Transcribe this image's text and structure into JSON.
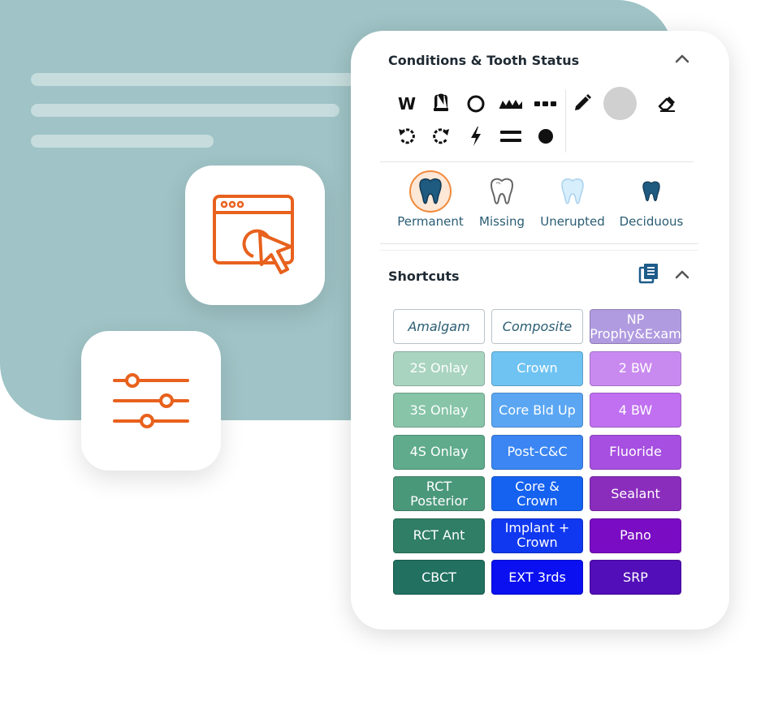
{
  "conditions": {
    "title": "Conditions & Tooth Status",
    "tools": [
      {
        "name": "wear-tool",
        "text": "W"
      },
      {
        "name": "crown-tool",
        "icon": "crown-icon"
      },
      {
        "name": "circle-tool",
        "icon": "circle-outline-icon"
      },
      {
        "name": "zigzag-tool",
        "icon": "zigzag-icon"
      },
      {
        "name": "dots-tool",
        "icon": "dots-icon"
      },
      {
        "name": "rotate-left-tool",
        "icon": "rotate-left-icon"
      },
      {
        "name": "rotate-right-tool",
        "icon": "rotate-right-icon"
      },
      {
        "name": "bolt-tool",
        "icon": "lightning-icon"
      },
      {
        "name": "equals-tool",
        "icon": "equals-icon"
      },
      {
        "name": "dot-tool",
        "icon": "filled-circle-icon"
      },
      {
        "name": "pencil-tool",
        "icon": "pencil-icon"
      },
      {
        "name": "color-swatch",
        "icon": "color-swatch-icon",
        "color": "#d0d0d0"
      },
      {
        "name": "eraser-tool",
        "icon": "eraser-icon"
      }
    ],
    "tooth_types": [
      {
        "label": "Permanent",
        "color": "#1f5a80",
        "selected": true
      },
      {
        "label": "Missing",
        "color": "#ffffff",
        "selected": false
      },
      {
        "label": "Unerupted",
        "color": "#d7eefc",
        "selected": false
      },
      {
        "label": "Deciduous",
        "color": "#1f5a80",
        "selected": false
      }
    ]
  },
  "shortcuts": {
    "title": "Shortcuts",
    "buttons": [
      [
        "Amalgam",
        "Composite",
        "NP Prophy&Exam"
      ],
      [
        "2S Onlay",
        "Crown",
        "2 BW"
      ],
      [
        "3S Onlay",
        "Core Bld Up",
        "4 BW"
      ],
      [
        "4S Onlay",
        "Post-C&C",
        "Fluoride"
      ],
      [
        "RCT Posterior",
        "Core & Crown",
        "Sealant"
      ],
      [
        "RCT Ant",
        "Implant + Crown",
        "Pano"
      ],
      [
        "CBCT",
        "EXT 3rds",
        "SRP"
      ]
    ],
    "colors": [
      [
        "#ffffff",
        "#ffffff",
        "#b09be0"
      ],
      [
        "#a9d4c0",
        "#6fc3f2",
        "#c98af0"
      ],
      [
        "#87c4a8",
        "#5aa6f3",
        "#c070f0"
      ],
      [
        "#5fab8c",
        "#3b86f3",
        "#a64fe0"
      ],
      [
        "#4a987a",
        "#1561f0",
        "#8a2dbd"
      ],
      [
        "#2f7e65",
        "#1038f0",
        "#7a0cc4"
      ],
      [
        "#217060",
        "#0a10f0",
        "#520eb8"
      ]
    ]
  }
}
